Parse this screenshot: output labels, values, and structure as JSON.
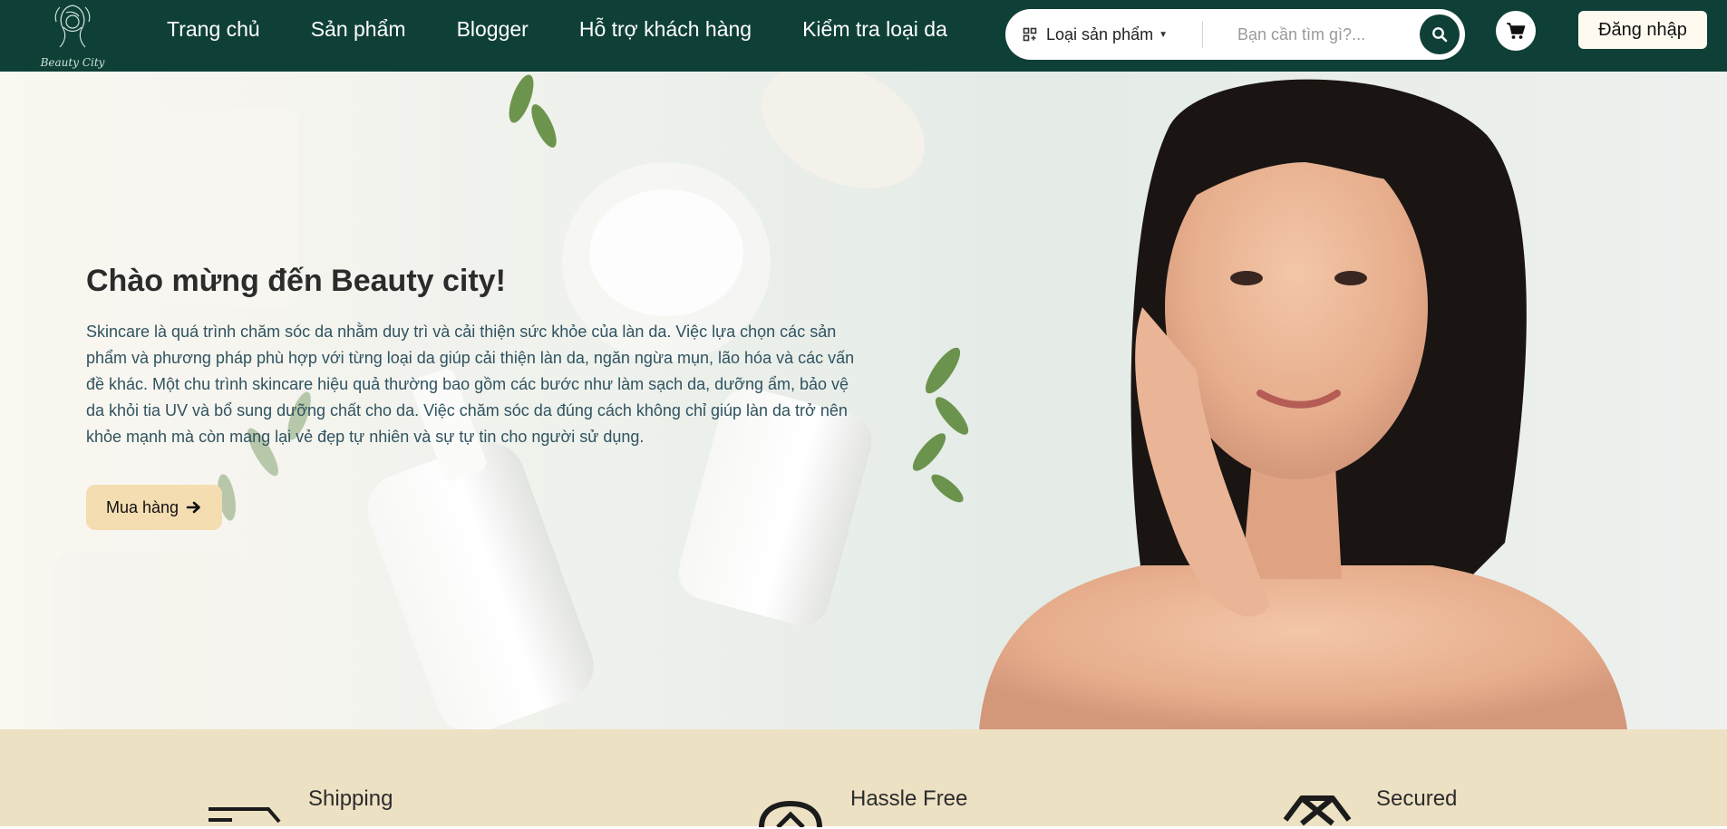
{
  "brand": {
    "logo_text": "Beauty City"
  },
  "nav": {
    "items": [
      {
        "label": "Trang chủ"
      },
      {
        "label": "Sản phẩm"
      },
      {
        "label": "Blogger"
      },
      {
        "label": "Hỗ trợ khách hàng"
      },
      {
        "label": "Kiểm tra loại da"
      }
    ]
  },
  "search": {
    "category_label": "Loại sản phẩm",
    "placeholder": "Bạn cần tìm gì?..."
  },
  "header": {
    "login_label": "Đăng nhập"
  },
  "hero": {
    "title": "Chào mừng đến Beauty city!",
    "description": "Skincare là quá trình chăm sóc da nhằm duy trì và cải thiện sức khỏe của làn da. Việc lựa chọn các sản phẩm và phương pháp phù hợp với từng loại da giúp cải thiện làn da, ngăn ngừa mụn, lão hóa và các vấn đề khác. Một chu trình skincare hiệu quả thường bao gồm các bước như làm sạch da, dưỡng ẩm, bảo vệ da khỏi tia UV và bổ sung dưỡng chất cho da. Việc chăm sóc da đúng cách không chỉ giúp làn da trở nên khỏe mạnh mà còn mang lại vẻ đẹp tự nhiên và sự tự tin cho người sử dụng.",
    "cta_label": "Mua hàng"
  },
  "features": [
    {
      "title": "Shipping",
      "icon": "truck-icon"
    },
    {
      "title": "Hassle Free",
      "icon": "badge-icon"
    },
    {
      "title": "Secured",
      "icon": "box-icon"
    }
  ],
  "colors": {
    "nav_bg": "#0f4037",
    "cta_bg": "#f5ddb2",
    "features_bg": "#ede1c4",
    "hero_text": "#2f5360"
  }
}
